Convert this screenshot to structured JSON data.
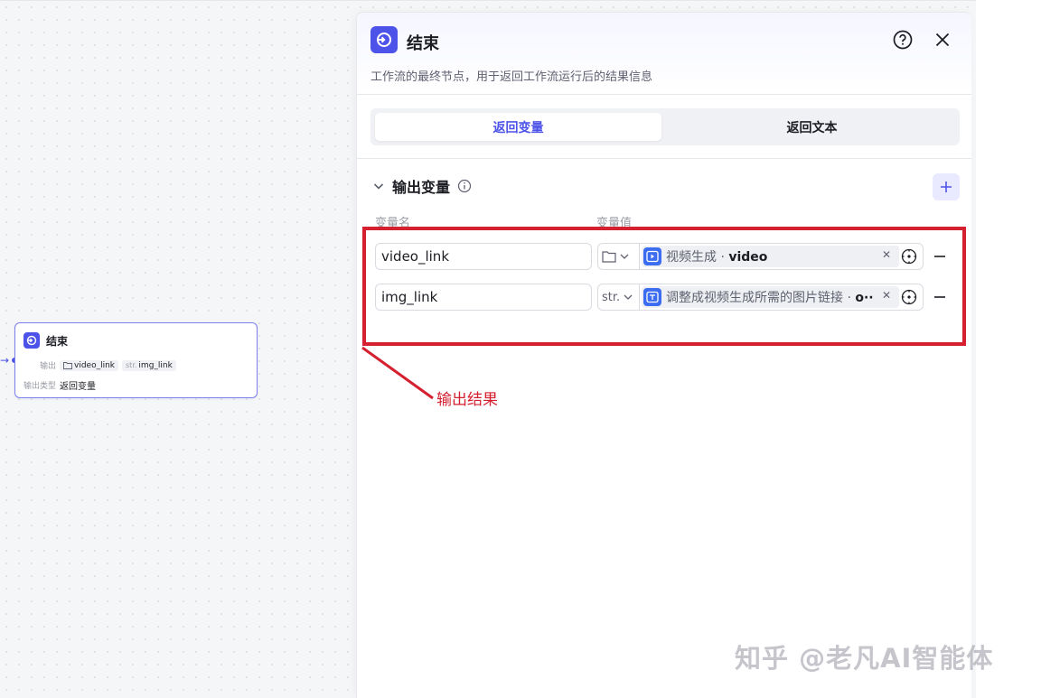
{
  "node": {
    "title": "结束",
    "output_label": "输出",
    "outputs": [
      {
        "prefix": "",
        "name": "video_link",
        "type_icon": "folder-icon"
      },
      {
        "prefix": "str.",
        "name": "img_link",
        "type_icon": "string-icon"
      }
    ],
    "output_type_label": "输出类型",
    "output_type_value": "返回变量"
  },
  "panel": {
    "title": "结束",
    "description": "工作流的最终节点，用于返回工作流运行后的结果信息",
    "tabs": [
      {
        "label": "返回变量",
        "active": true
      },
      {
        "label": "返回文本",
        "active": false
      }
    ],
    "section": {
      "title": "输出变量",
      "col_name": "变量名",
      "col_value": "变量值",
      "rows": [
        {
          "name": "video_link",
          "type_label": "",
          "ref_source": "视频生成",
          "ref_sep": " · ",
          "ref_var": "video"
        },
        {
          "name": "img_link",
          "type_label": "str.",
          "ref_source": "调整成视频生成所需的图片链接",
          "ref_sep": " · ",
          "ref_var": "o··"
        }
      ]
    }
  },
  "annotation": {
    "callout": "输出结果",
    "color": "#d4202f"
  },
  "watermark": "知乎 @老凡AI智能体",
  "colors": {
    "accent": "#4d53e8",
    "ref_icon": "#3c6df0"
  }
}
